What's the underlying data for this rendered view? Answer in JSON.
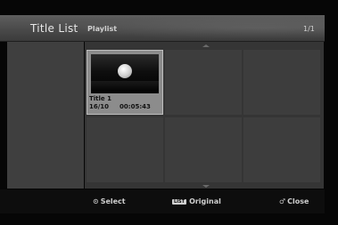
{
  "header": {
    "title": "Title List",
    "subtitle": "Playlist",
    "page": "1/1"
  },
  "grid": {
    "selected_item": {
      "title": "Title 1",
      "date": "16/10",
      "duration": "00:05:43"
    }
  },
  "footer": {
    "select_icon": "enter-icon",
    "select_label": "Select",
    "list_badge": "LIST",
    "original_label": "Original",
    "close_icon": "return-icon",
    "close_label": "Close"
  }
}
